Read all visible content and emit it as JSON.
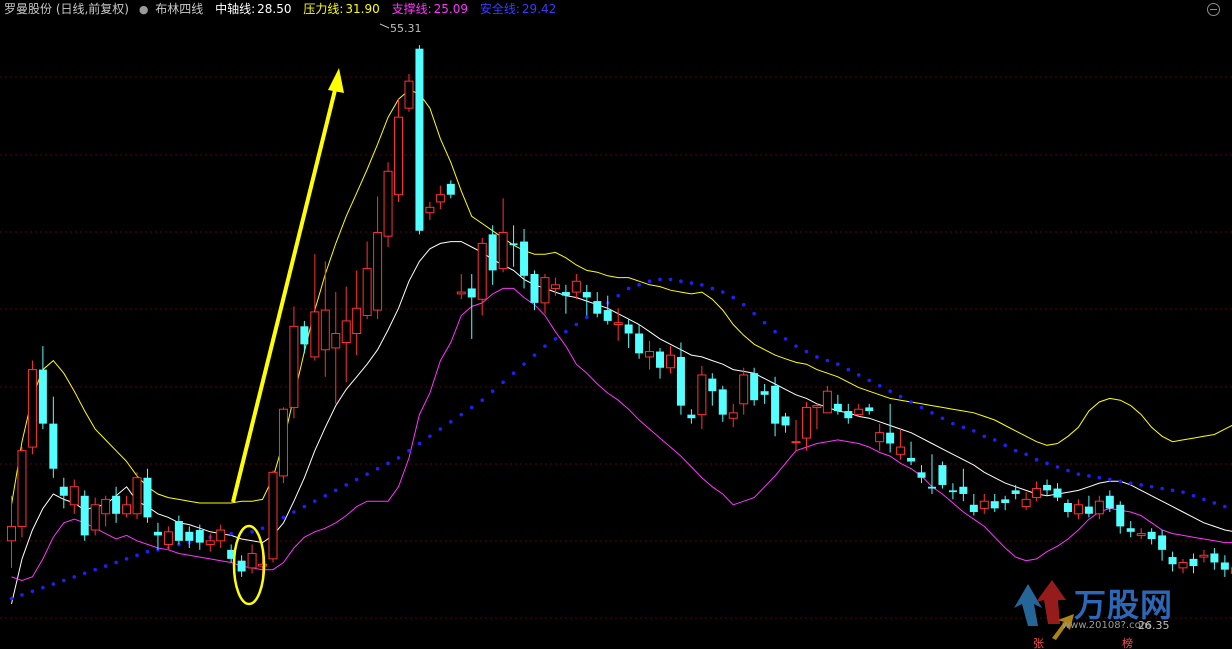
{
  "legend": {
    "title": "罗曼股份 (日线,前复权)",
    "indicator": "布林四线",
    "lines": [
      {
        "label": "中轴线:",
        "value": "28.50",
        "color": "#ffffff"
      },
      {
        "label": "压力线:",
        "value": "31.90",
        "color": "#ffff00"
      },
      {
        "label": "支撑线:",
        "value": "25.09",
        "color": "#ff33ff"
      },
      {
        "label": "安全线:",
        "value": "29.42",
        "color": "#1e1eff"
      }
    ]
  },
  "annotations": {
    "high_label": "55.31",
    "low_label": "26.35",
    "marker_zhang": "张",
    "marker_bang": "榜"
  },
  "watermark": {
    "text": "万股网",
    "url": "www.20108?.com"
  },
  "colors": {
    "up": "#ff3232",
    "down": "#54ffff",
    "mid": "#ffffff",
    "upper": "#ffff00",
    "lower": "#ff33ff",
    "safe": "#1e1eff",
    "arrow": "#ffff00",
    "grid": "#550000"
  },
  "chart_data": {
    "type": "candlestick",
    "title": "罗曼股份 (日线,前复权)",
    "ylim": [
      22,
      58
    ],
    "candles": [
      [
        28.0,
        28.8,
        26.5,
        30.5
      ],
      [
        28.8,
        33.0,
        28.2,
        33.2
      ],
      [
        33.2,
        37.5,
        32.8,
        38.0
      ],
      [
        37.5,
        34.5,
        34.2,
        38.8
      ],
      [
        34.5,
        32.0,
        31.5,
        36.0
      ],
      [
        31.0,
        30.5,
        29.8,
        31.5
      ],
      [
        30.0,
        31.0,
        29.5,
        31.4
      ],
      [
        30.5,
        28.3,
        28.0,
        30.8
      ],
      [
        28.6,
        30.0,
        28.3,
        30.4
      ],
      [
        29.5,
        30.3,
        28.8,
        30.5
      ],
      [
        30.5,
        29.5,
        29.0,
        31.0
      ],
      [
        29.5,
        30.0,
        29.3,
        30.5
      ],
      [
        29.5,
        31.5,
        29.2,
        31.8
      ],
      [
        31.5,
        29.3,
        29.0,
        32.0
      ],
      [
        28.5,
        28.3,
        27.5,
        29.0
      ],
      [
        27.8,
        28.5,
        27.5,
        28.8
      ],
      [
        29.1,
        28.0,
        27.8,
        29.4
      ],
      [
        28.5,
        28.0,
        27.6,
        28.8
      ],
      [
        28.6,
        27.9,
        27.5,
        28.9
      ],
      [
        27.8,
        28.0,
        27.4,
        28.4
      ],
      [
        28.0,
        28.6,
        27.6,
        28.9
      ],
      [
        27.5,
        27.0,
        26.8,
        27.8
      ],
      [
        26.9,
        26.3,
        26.0,
        27.2
      ],
      [
        26.5,
        27.3,
        26.2,
        27.8
      ],
      [
        26.6,
        26.7,
        26.0,
        27.5
      ],
      [
        27.0,
        31.8,
        26.8,
        31.9
      ],
      [
        31.6,
        35.3,
        31.2,
        35.4
      ],
      [
        35.4,
        39.9,
        34.8,
        41.0
      ],
      [
        39.9,
        38.9,
        38.4,
        40.2
      ],
      [
        38.2,
        40.7,
        38.0,
        43.9
      ],
      [
        38.6,
        40.8,
        37.1,
        43.5
      ],
      [
        38.7,
        39.5,
        35.6,
        41.8
      ],
      [
        39.0,
        40.2,
        36.8,
        42.1
      ],
      [
        39.5,
        40.9,
        38.3,
        43.0
      ],
      [
        40.5,
        43.1,
        40.3,
        44.6
      ],
      [
        40.8,
        45.1,
        40.3,
        47.1
      ],
      [
        44.9,
        48.5,
        44.3,
        49.0
      ],
      [
        47.2,
        51.5,
        46.8,
        52.5
      ],
      [
        52.0,
        53.5,
        51.8,
        53.9
      ],
      [
        55.3,
        45.2,
        45.0,
        55.5
      ],
      [
        46.2,
        46.5,
        45.8,
        46.8
      ],
      [
        46.8,
        47.2,
        46.4,
        47.7
      ],
      [
        47.8,
        47.2,
        47.0,
        48.0
      ],
      [
        41.7,
        41.8,
        41.4,
        42.8
      ],
      [
        42.0,
        41.5,
        39.2,
        42.8
      ],
      [
        41.4,
        44.5,
        40.5,
        44.8
      ],
      [
        45.0,
        43.0,
        42.2,
        45.5
      ],
      [
        43.1,
        45.1,
        42.9,
        47.0
      ],
      [
        44.5,
        44.4,
        43.2,
        45.5
      ],
      [
        44.6,
        42.7,
        42.0,
        45.3
      ],
      [
        42.8,
        41.2,
        40.8,
        43.0
      ],
      [
        41.2,
        42.6,
        40.6,
        42.8
      ],
      [
        42.0,
        42.2,
        41.6,
        42.6
      ],
      [
        41.8,
        41.6,
        40.6,
        42.2
      ],
      [
        41.8,
        42.4,
        41.4,
        42.8
      ],
      [
        41.8,
        41.5,
        40.5,
        42.2
      ],
      [
        41.3,
        40.6,
        40.4,
        41.8
      ],
      [
        40.8,
        40.2,
        40.0,
        41.6
      ],
      [
        40.0,
        40.1,
        39.1,
        40.9
      ],
      [
        40.0,
        39.5,
        38.7,
        40.3
      ],
      [
        39.5,
        38.4,
        38.1,
        40.0
      ],
      [
        38.2,
        38.5,
        37.5,
        39.1
      ],
      [
        38.5,
        37.6,
        37.0,
        38.7
      ],
      [
        37.6,
        38.3,
        37.3,
        38.8
      ],
      [
        38.2,
        35.5,
        35.0,
        39.0
      ],
      [
        35.0,
        34.8,
        34.5,
        35.3
      ],
      [
        35.0,
        37.2,
        34.2,
        37.7
      ],
      [
        37.0,
        36.3,
        35.5,
        37.3
      ],
      [
        36.4,
        35.0,
        34.6,
        36.6
      ],
      [
        34.8,
        35.1,
        34.3,
        35.6
      ],
      [
        35.6,
        37.2,
        35.0,
        37.6
      ],
      [
        37.3,
        35.8,
        35.5,
        37.6
      ],
      [
        36.3,
        36.1,
        35.6,
        36.7
      ],
      [
        36.6,
        34.5,
        33.8,
        37.1
      ],
      [
        34.9,
        34.4,
        34.0,
        35.1
      ],
      [
        33.5,
        33.5,
        33.0,
        34.7
      ],
      [
        33.7,
        35.4,
        33.0,
        35.7
      ],
      [
        35.4,
        35.5,
        34.2,
        35.6
      ],
      [
        35.1,
        36.3,
        35.3,
        36.6
      ],
      [
        35.6,
        35.2,
        35.0,
        36.1
      ],
      [
        35.2,
        34.8,
        34.5,
        35.6
      ],
      [
        35.0,
        35.3,
        34.9,
        35.6
      ],
      [
        35.4,
        35.2,
        35.0,
        35.6
      ],
      [
        33.5,
        34.0,
        33.0,
        34.5
      ],
      [
        34.0,
        33.4,
        32.9,
        35.6
      ],
      [
        32.8,
        33.2,
        32.5,
        34.2
      ],
      [
        32.6,
        32.4,
        32.2,
        33.5
      ],
      [
        31.8,
        31.5,
        31.2,
        32.2
      ],
      [
        31.0,
        30.9,
        30.6,
        32.8
      ],
      [
        32.2,
        31.1,
        30.9,
        32.4
      ],
      [
        30.8,
        30.7,
        30.3,
        31.2
      ],
      [
        31.0,
        30.6,
        30.2,
        32.0
      ],
      [
        30.0,
        29.6,
        29.4,
        30.6
      ],
      [
        29.8,
        30.2,
        29.5,
        30.6
      ],
      [
        30.2,
        29.8,
        29.6,
        30.6
      ],
      [
        30.3,
        30.1,
        29.7,
        30.5
      ],
      [
        30.8,
        30.6,
        30.3,
        31.1
      ],
      [
        29.9,
        30.3,
        29.7,
        30.7
      ],
      [
        30.4,
        30.9,
        30.2,
        31.3
      ],
      [
        31.1,
        30.8,
        30.5,
        31.4
      ],
      [
        30.9,
        30.4,
        30.2,
        31.2
      ],
      [
        30.1,
        29.6,
        29.3,
        30.3
      ],
      [
        29.5,
        30.0,
        29.2,
        30.3
      ],
      [
        29.9,
        29.5,
        29.3,
        30.5
      ],
      [
        29.5,
        30.2,
        29.2,
        30.5
      ],
      [
        30.5,
        29.8,
        29.6,
        30.8
      ],
      [
        30.0,
        28.8,
        28.4,
        30.2
      ],
      [
        28.7,
        28.5,
        28.2,
        29.1
      ],
      [
        28.3,
        28.4,
        28.1,
        28.7
      ],
      [
        28.5,
        28.1,
        27.8,
        28.7
      ],
      [
        28.3,
        27.5,
        26.9,
        28.6
      ],
      [
        27.1,
        26.7,
        26.3,
        27.4
      ],
      [
        26.5,
        26.8,
        26.2,
        27.0
      ],
      [
        27.0,
        26.6,
        26.2,
        27.3
      ],
      [
        27.1,
        27.2,
        26.8,
        27.5
      ],
      [
        27.3,
        26.8,
        26.4,
        27.6
      ],
      [
        26.8,
        26.4,
        26.0,
        27.2
      ],
      [
        26.2,
        26.5,
        26.0,
        26.8
      ]
    ],
    "series": [
      {
        "name": "中轴线",
        "color": "#ffffff",
        "values": [
          24.5,
          27.0,
          28.6,
          29.8,
          30.6,
          30.3,
          30.1,
          29.7,
          29.9,
          30.0,
          30.5,
          31.0,
          30.2,
          29.9,
          29.5,
          29.3,
          29.0,
          28.9,
          28.7,
          28.5,
          28.4,
          28.3,
          28.1,
          28.0,
          27.9,
          28.3,
          29.0,
          30.2,
          31.5,
          33.0,
          34.3,
          35.5,
          36.4,
          37.1,
          37.8,
          38.6,
          39.7,
          40.9,
          42.4,
          43.5,
          44.2,
          44.5,
          44.6,
          44.6,
          44.3,
          44.0,
          43.6,
          43.3,
          43.0,
          42.5,
          42.2,
          42.0,
          41.8,
          41.6,
          41.5,
          41.3,
          41.1,
          40.9,
          40.6,
          40.3,
          40.0,
          39.6,
          39.2,
          38.9,
          38.6,
          38.3,
          38.2,
          38.0,
          37.8,
          37.5,
          37.4,
          37.3,
          37.0,
          36.7,
          36.4,
          36.1,
          35.9,
          35.6,
          35.4,
          35.2,
          35.1,
          34.9,
          34.8,
          34.6,
          34.4,
          34.2,
          34.0,
          33.7,
          33.4,
          33.1,
          32.8,
          32.5,
          32.2,
          31.8,
          31.5,
          31.2,
          31.0,
          30.8,
          30.6,
          30.5,
          30.6,
          30.7,
          30.8,
          31.0,
          31.2,
          31.3,
          31.3,
          31.1,
          30.8,
          30.5,
          30.2,
          29.9,
          29.6,
          29.3,
          29.0,
          28.8,
          28.6,
          28.5
        ]
      },
      {
        "name": "压力线",
        "color": "#ffff00",
        "values": [
          30.0,
          33.5,
          36.0,
          37.5,
          38.0,
          37.3,
          36.3,
          35.2,
          34.2,
          33.6,
          33.0,
          32.4,
          31.6,
          31.0,
          30.6,
          30.4,
          30.3,
          30.2,
          30.1,
          30.1,
          30.1,
          30.1,
          30.2,
          30.2,
          30.3,
          31.5,
          33.5,
          36.0,
          38.5,
          40.8,
          42.8,
          44.5,
          46.0,
          47.3,
          48.6,
          50.0,
          51.5,
          52.5,
          53.0,
          52.8,
          52.0,
          50.3,
          49.0,
          47.4,
          46.0,
          45.6,
          45.2,
          44.8,
          44.4,
          44.1,
          43.9,
          43.9,
          44.0,
          43.7,
          43.3,
          43.0,
          42.9,
          42.7,
          42.6,
          42.6,
          42.4,
          42.2,
          42.1,
          41.9,
          41.8,
          41.7,
          41.8,
          41.4,
          40.8,
          40.0,
          39.4,
          38.9,
          38.6,
          38.3,
          38.1,
          37.9,
          37.8,
          37.5,
          37.3,
          37.1,
          36.8,
          36.5,
          36.3,
          36.1,
          35.9,
          35.8,
          35.7,
          35.6,
          35.5,
          35.4,
          35.3,
          35.2,
          35.1,
          34.9,
          34.7,
          34.4,
          34.1,
          33.8,
          33.5,
          33.3,
          33.4,
          33.8,
          34.3,
          35.2,
          35.7,
          35.9,
          35.8,
          35.5,
          35.0,
          34.3,
          33.8,
          33.5,
          33.6,
          33.7,
          33.8,
          33.9,
          34.2,
          34.5
        ]
      },
      {
        "name": "支撑线",
        "color": "#ff33ff",
        "values": [
          26.0,
          25.8,
          26.0,
          27.0,
          28.2,
          29.0,
          29.2,
          29.0,
          28.7,
          28.4,
          28.1,
          28.3,
          28.0,
          27.8,
          27.6,
          27.5,
          27.3,
          27.2,
          27.1,
          27.0,
          26.9,
          26.8,
          26.6,
          26.5,
          26.4,
          26.4,
          26.8,
          27.6,
          28.2,
          28.5,
          28.7,
          29.0,
          29.4,
          29.9,
          30.2,
          30.2,
          30.2,
          31.0,
          32.6,
          35.0,
          36.2,
          38.0,
          39.0,
          40.5,
          41.0,
          41.2,
          41.7,
          42.0,
          42.0,
          41.5,
          41.1,
          40.5,
          39.6,
          38.8,
          37.8,
          37.3,
          36.7,
          36.2,
          35.8,
          35.3,
          34.7,
          34.2,
          33.7,
          33.2,
          32.7,
          32.1,
          31.5,
          31.0,
          30.6,
          30.0,
          30.2,
          30.4,
          31.0,
          31.6,
          32.3,
          33.0,
          33.2,
          33.4,
          33.5,
          33.6,
          33.5,
          33.4,
          33.2,
          32.9,
          32.7,
          32.3,
          32.0,
          31.6,
          31.0,
          30.6,
          30.1,
          29.6,
          29.2,
          28.8,
          28.2,
          27.6,
          27.1,
          26.9,
          27.0,
          27.4,
          27.7,
          28.1,
          28.6,
          29.2,
          29.6,
          29.8,
          29.7,
          29.6,
          29.4,
          29.0,
          28.6,
          28.4,
          28.3,
          28.2,
          28.1,
          28.0,
          27.9,
          27.9
        ]
      },
      {
        "name": "安全线",
        "color": "#1e1eff",
        "values": [
          24.8,
          25.0,
          25.2,
          25.4,
          25.6,
          25.8,
          26.0,
          26.2,
          26.4,
          26.6,
          26.8,
          27.0,
          27.2,
          27.4,
          27.5,
          27.6,
          27.8,
          27.9,
          28.1,
          28.2,
          28.3,
          28.4,
          28.5,
          28.5,
          28.7,
          29.0,
          29.3,
          29.6,
          29.9,
          30.2,
          30.5,
          30.8,
          31.1,
          31.4,
          31.7,
          32.0,
          32.3,
          32.6,
          33.0,
          33.4,
          33.8,
          34.2,
          34.6,
          35.0,
          35.4,
          35.8,
          36.3,
          36.8,
          37.3,
          37.8,
          38.3,
          38.8,
          39.2,
          39.6,
          40.0,
          40.4,
          40.8,
          41.2,
          41.6,
          42.0,
          42.2,
          42.4,
          42.5,
          42.5,
          42.4,
          42.3,
          42.2,
          42.0,
          41.8,
          41.5,
          41.1,
          40.6,
          40.1,
          39.6,
          39.2,
          38.8,
          38.5,
          38.2,
          38.0,
          37.8,
          37.5,
          37.2,
          36.9,
          36.6,
          36.3,
          36.0,
          35.7,
          35.4,
          35.1,
          34.8,
          34.5,
          34.3,
          34.1,
          33.8,
          33.6,
          33.3,
          33.0,
          32.8,
          32.5,
          32.3,
          32.1,
          31.9,
          31.7,
          31.6,
          31.5,
          31.4,
          31.3,
          31.2,
          31.1,
          31.0,
          30.9,
          30.8,
          30.7,
          30.5,
          30.3,
          30.1,
          29.9,
          29.7
        ]
      }
    ]
  }
}
